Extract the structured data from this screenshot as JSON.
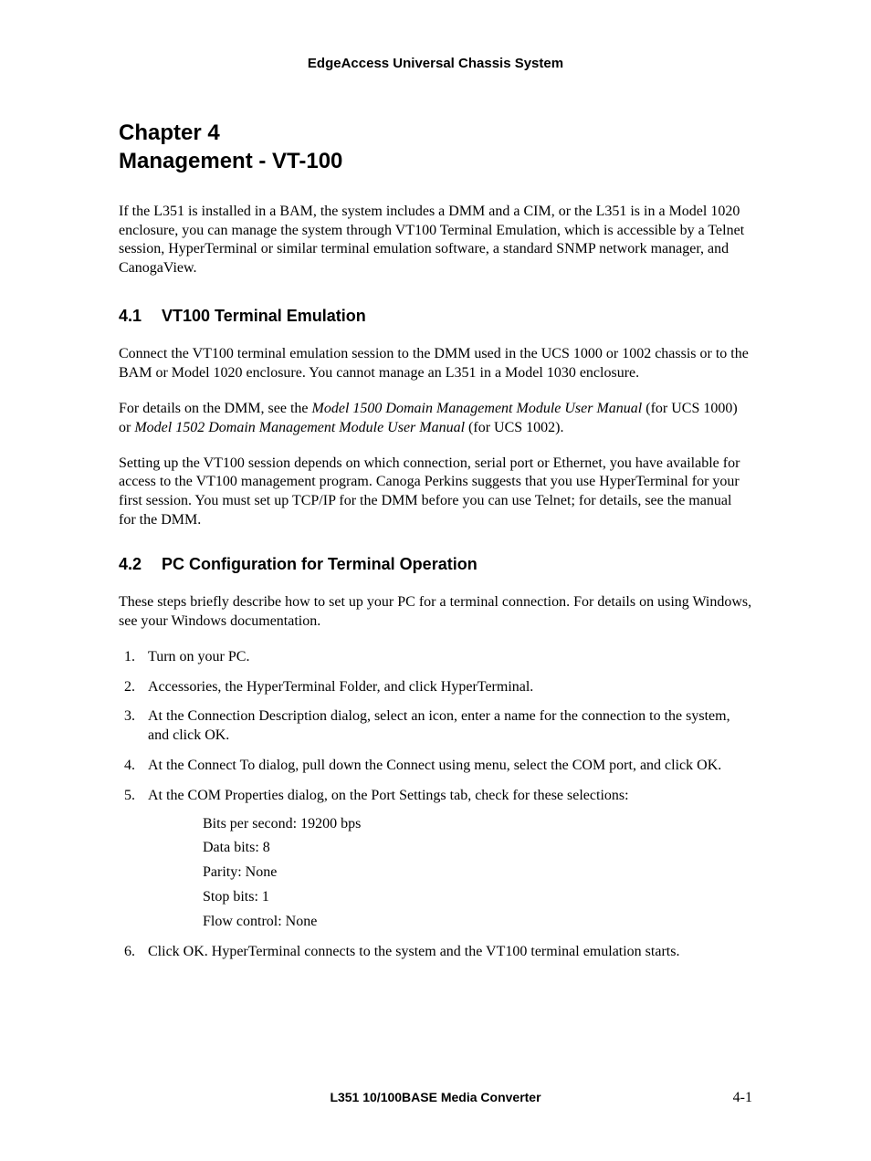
{
  "header": "EdgeAccess Universal Chassis System",
  "chapter": {
    "line1": "Chapter 4",
    "line2": "Management - VT-100"
  },
  "intro": "If the L351 is installed in a BAM, the system includes a DMM and a CIM, or the L351 is in a Model 1020 enclosure, you can manage the system through VT100 Terminal Emulation, which is accessible by a Telnet session, HyperTerminal or similar terminal emulation software, a standard SNMP network manager, and CanogaView.",
  "section1": {
    "num": "4.1",
    "title": "VT100 Terminal Emulation",
    "p1": "Connect the VT100 terminal emulation session to the DMM used in the UCS 1000 or 1002 chassis or to the BAM or Model 1020 enclosure.  You cannot manage an L351 in a Model 1030 enclosure.",
    "p2a": "For details on the DMM, see the ",
    "p2i1": "Model 1500 Domain Management Module User Manual",
    "p2b": " (for UCS 1000) or ",
    "p2i2": "Model 1502 Domain Management Module User Manual",
    "p2c": " (for UCS 1002).",
    "p3": "Setting up the VT100 session depends on which connection, serial port or Ethernet, you have available for access to the VT100 management program.  Canoga Perkins suggests that you use HyperTerminal for your first session.  You must set up TCP/IP for the DMM before you can use Telnet; for details, see the manual for the DMM."
  },
  "section2": {
    "num": "4.2",
    "title": "PC Configuration for Terminal Operation",
    "p1": "These steps briefly describe how to set up your PC for a terminal connection.  For details on using Windows, see your Windows documentation.",
    "steps": [
      "Turn on your PC.",
      "Accessories, the HyperTerminal Folder, and click HyperTerminal.",
      "At the Connection Description dialog, select an icon, enter a name for the connection to the system, and click OK.",
      "At the Connect To dialog, pull down the Connect using menu, select the COM port, and click OK.",
      "At the COM Properties dialog, on the Port Settings tab, check for these selections:",
      "Click OK.  HyperTerminal connects to the system and the VT100 terminal emulation starts."
    ],
    "settings": [
      "Bits per second:  19200 bps",
      "Data bits:  8",
      "Parity:  None",
      "Stop bits:  1",
      "Flow control:  None"
    ]
  },
  "footer": {
    "title": "L351 10/100BASE Media Converter",
    "page": "4-1"
  }
}
